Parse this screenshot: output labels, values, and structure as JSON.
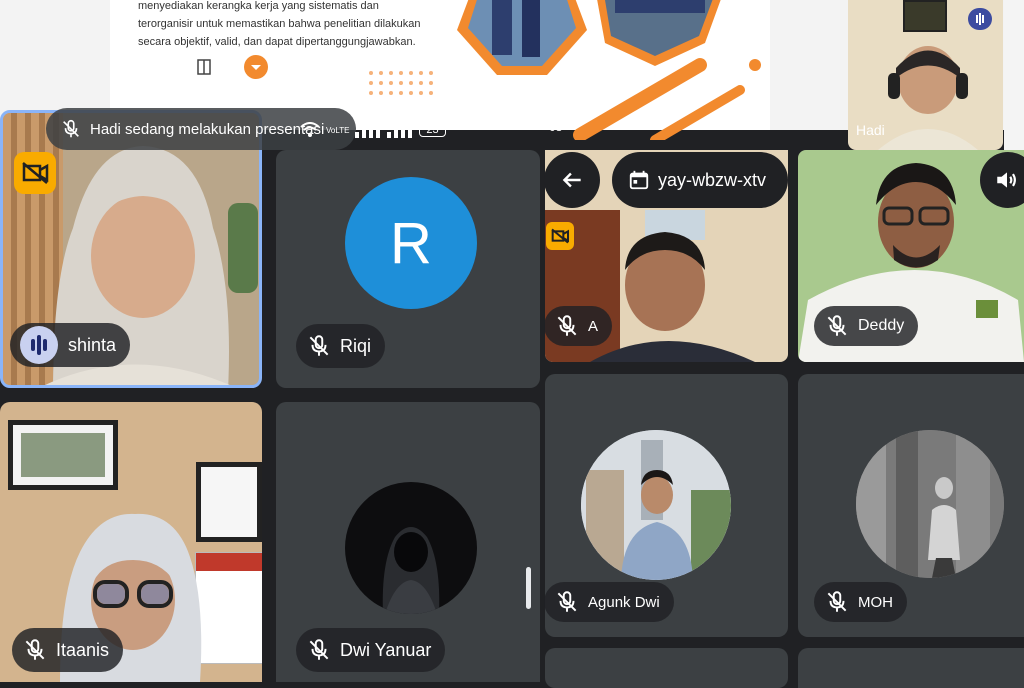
{
  "slide": {
    "text_line1": "menyediakan kerangka kerja yang sistematis dan",
    "text_line2": "terorganisir untuk memastikan bahwa penelitian dilakukan",
    "text_line3": "secara objektif, valid, dan dapat dipertanggungjawabkan."
  },
  "presentation_banner": {
    "text": "Hadi sedang melakukan presentasi"
  },
  "status_bar": {
    "battery": "23",
    "network": "VoLTE",
    "time_fragment": "08"
  },
  "meeting": {
    "code": "yay-wbzw-xtv"
  },
  "self_view": {
    "name": "Hadi"
  },
  "participants": [
    {
      "name": "shinta",
      "initial": ""
    },
    {
      "name": "Riqi",
      "initial": "R"
    },
    {
      "name": "A",
      "initial": ""
    },
    {
      "name": "Deddy",
      "initial": ""
    },
    {
      "name": "Itaanis",
      "initial": ""
    },
    {
      "name": "Dwi Yanuar",
      "initial": ""
    },
    {
      "name": "Agunk Dwi",
      "initial": ""
    },
    {
      "name": "MOH",
      "initial": ""
    }
  ],
  "colors": {
    "background": "#202124",
    "tile": "#3c4043",
    "riqi_avatar": "#1e8fd9",
    "accent_orange": "#f28a2e",
    "speaking_border": "#8ab4f8",
    "no_video_badge": "#f9ab00"
  },
  "icons": [
    "mic-off-icon",
    "back-arrow-icon",
    "calendar-icon",
    "speaker-icon",
    "no-video-icon",
    "audio-wave-icon",
    "wifi-icon",
    "signal-icon"
  ]
}
